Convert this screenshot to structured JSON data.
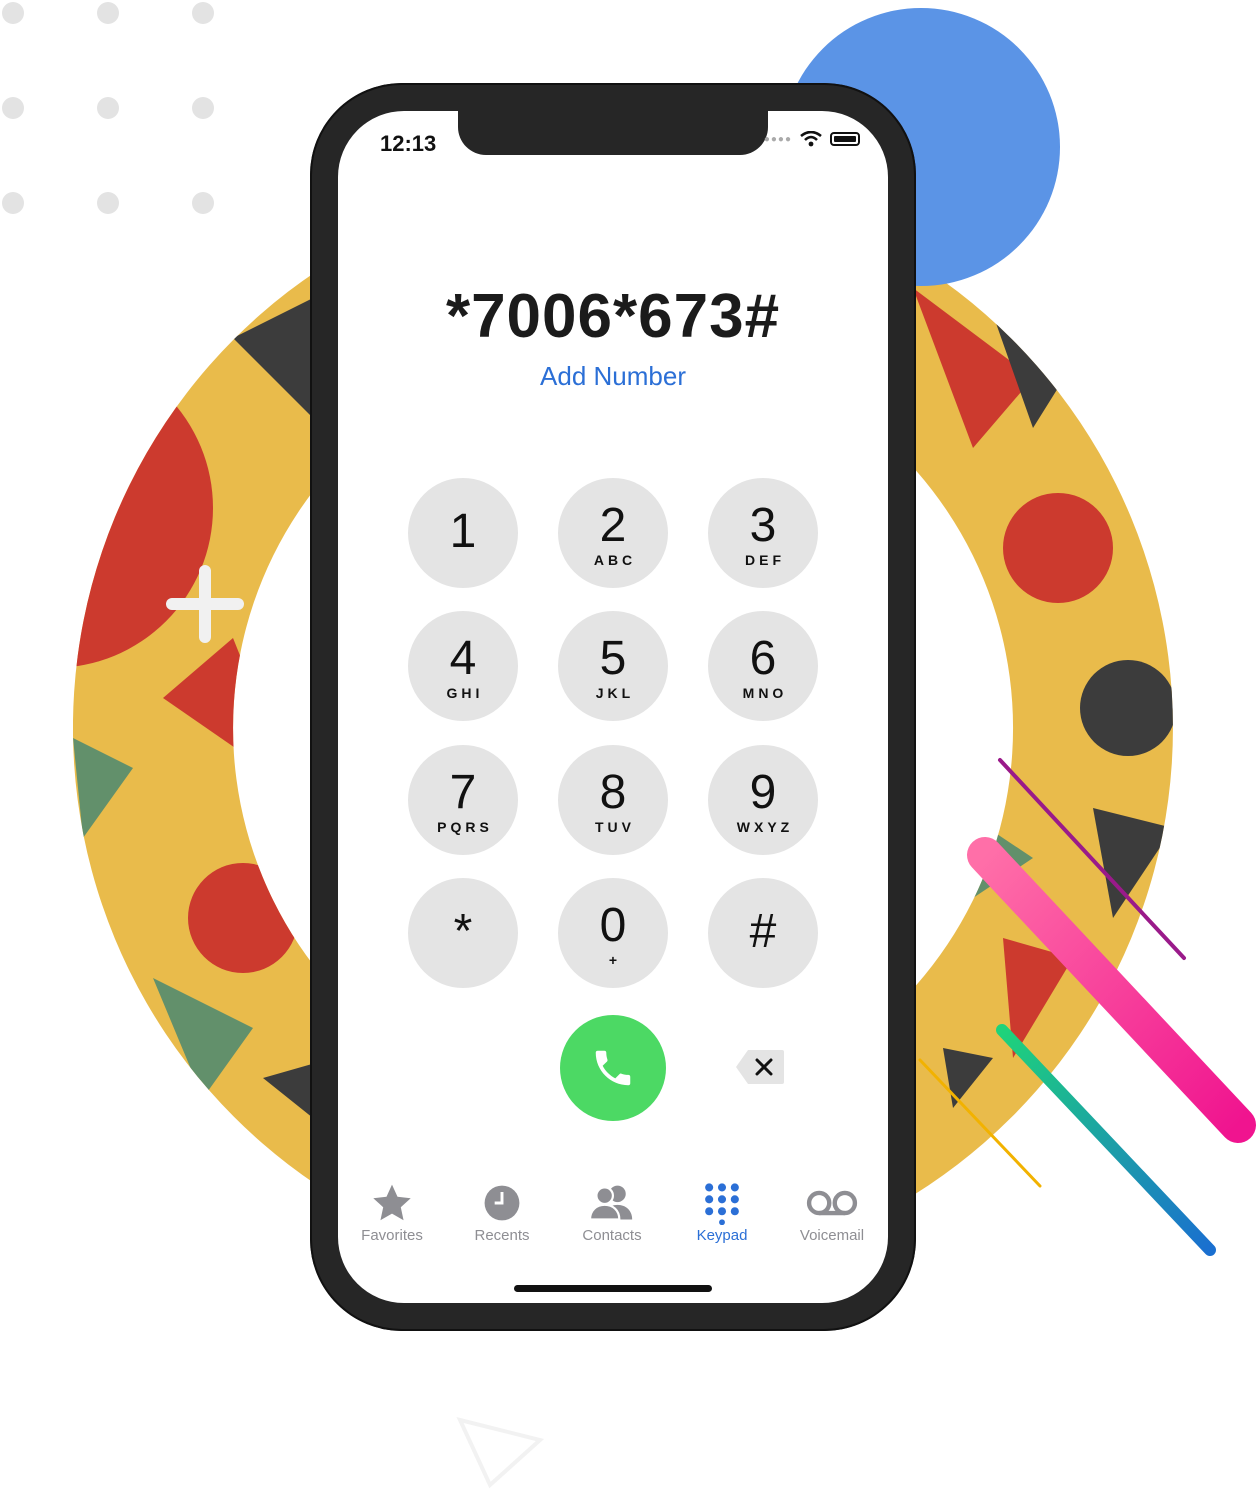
{
  "status_bar": {
    "time": "12:13"
  },
  "dialer": {
    "dialed_number": "*7006*673#",
    "add_number_label": "Add Number"
  },
  "keypad": [
    {
      "digit": "1",
      "letters": ""
    },
    {
      "digit": "2",
      "letters": "ABC"
    },
    {
      "digit": "3",
      "letters": "DEF"
    },
    {
      "digit": "4",
      "letters": "GHI"
    },
    {
      "digit": "5",
      "letters": "JKL"
    },
    {
      "digit": "6",
      "letters": "MNO"
    },
    {
      "digit": "7",
      "letters": "PQRS"
    },
    {
      "digit": "8",
      "letters": "TUV"
    },
    {
      "digit": "9",
      "letters": "WXYZ"
    },
    {
      "digit": "*",
      "letters": ""
    },
    {
      "digit": "0",
      "letters": "+"
    },
    {
      "digit": "#",
      "letters": ""
    }
  ],
  "actions": {
    "call_icon": "phone-icon",
    "delete_icon": "backspace-icon"
  },
  "tabbar": {
    "items": [
      {
        "label": "Favorites",
        "icon": "star-icon",
        "active": false
      },
      {
        "label": "Recents",
        "icon": "clock-icon",
        "active": false
      },
      {
        "label": "Contacts",
        "icon": "contacts-icon",
        "active": false
      },
      {
        "label": "Keypad",
        "icon": "keypad-icon",
        "active": true
      },
      {
        "label": "Voicemail",
        "icon": "voicemail-icon",
        "active": false
      }
    ]
  },
  "colors": {
    "accent": "#2b6fd6",
    "call_green": "#4cd964",
    "key_gray": "#e4e4e4",
    "phone_frame": "#262626",
    "ring_yellow": "#e9bb4b",
    "shape_red": "#cc3a2e",
    "shape_dark": "#3c3c3c",
    "shape_green": "#62906b",
    "blue_circle": "#5b94e6"
  }
}
